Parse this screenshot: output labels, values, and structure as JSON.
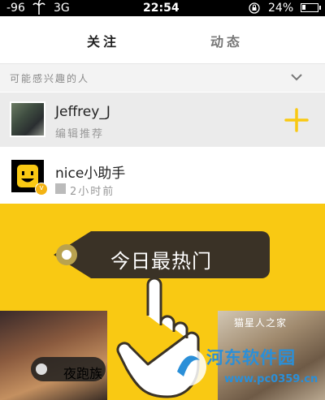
{
  "status_bar": {
    "signal": "-96",
    "network": "3G",
    "time": "22:54",
    "battery": "24%"
  },
  "tabs": [
    {
      "label": "关注"
    },
    {
      "label": "动态"
    }
  ],
  "suggestions": {
    "header": "可能感兴趣的人",
    "users": [
      {
        "name": "Jeffrey_J",
        "subtitle": "编辑推荐"
      },
      {
        "name": "nice小助手",
        "subtitle": "2小时前"
      }
    ]
  },
  "promo": {
    "label": "今日最热门",
    "tag_left": "夜跑族",
    "tag_right": "猫星人之家"
  },
  "watermark": {
    "title": "河东软件园",
    "url": "www.pc0359.cn"
  },
  "colors": {
    "accent": "#f9c913",
    "tag": "#3a3226"
  }
}
